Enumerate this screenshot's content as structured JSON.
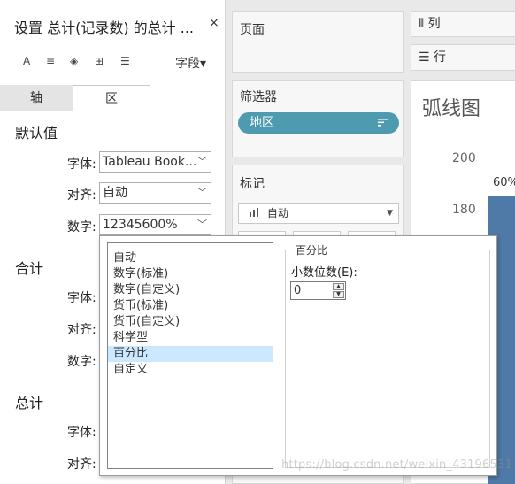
{
  "format_pane": {
    "title": "设置 总计(记录数) 的总计 ...",
    "close_glyph": "×",
    "toolbar": {
      "font_glyph": "A",
      "align_glyph": "≡",
      "shading_glyph": "◈",
      "borders_glyph": "⊞",
      "lines_glyph": "☰",
      "fields_label": "字段▾"
    },
    "tabs": [
      {
        "label": "轴"
      },
      {
        "label": "区"
      }
    ],
    "sections": {
      "default": {
        "heading": "默认值",
        "font_label": "字体:",
        "font_value": "Tableau Book...",
        "align_label": "对齐:",
        "align_value": "自动",
        "number_label": "数字:",
        "number_value": "12345600%"
      },
      "total": {
        "heading": "合计",
        "font_label": "字体:",
        "align_label": "对齐:",
        "number_label": "数字:"
      },
      "grand_total": {
        "heading": "总计",
        "font_label": "字体:",
        "align_label": "对齐:"
      }
    }
  },
  "cards": {
    "pages": {
      "title": "页面"
    },
    "filters": {
      "title": "筛选器",
      "pill_label": "地区",
      "pill_icon": "sort-icon"
    },
    "marks": {
      "title": "标记",
      "type_label": "自动",
      "type_icon": "bar-chart-icon"
    }
  },
  "shelves": {
    "columns": {
      "label": "⦀ 列"
    },
    "rows": {
      "label": "☰ 行"
    }
  },
  "viz": {
    "title": "弧线图",
    "yticks": [
      "200",
      "180"
    ],
    "bar_label": "60%",
    "bar_color": "#4f79a6"
  },
  "number_format_popup": {
    "options": [
      "自动",
      "数字(标准)",
      "数字(自定义)",
      "货币(标准)",
      "货币(自定义)",
      "科学型",
      "百分比",
      "自定义"
    ],
    "selected_index": 6,
    "group_title": "百分比",
    "decimals_label": "小数位数(E):",
    "decimals_value": "0"
  },
  "watermark": "https://blog.csdn.net/weixin_43196531",
  "colors": {
    "pill": "#4e9aaf",
    "selection": "#cce8ff",
    "bar": "#4f79a6"
  }
}
